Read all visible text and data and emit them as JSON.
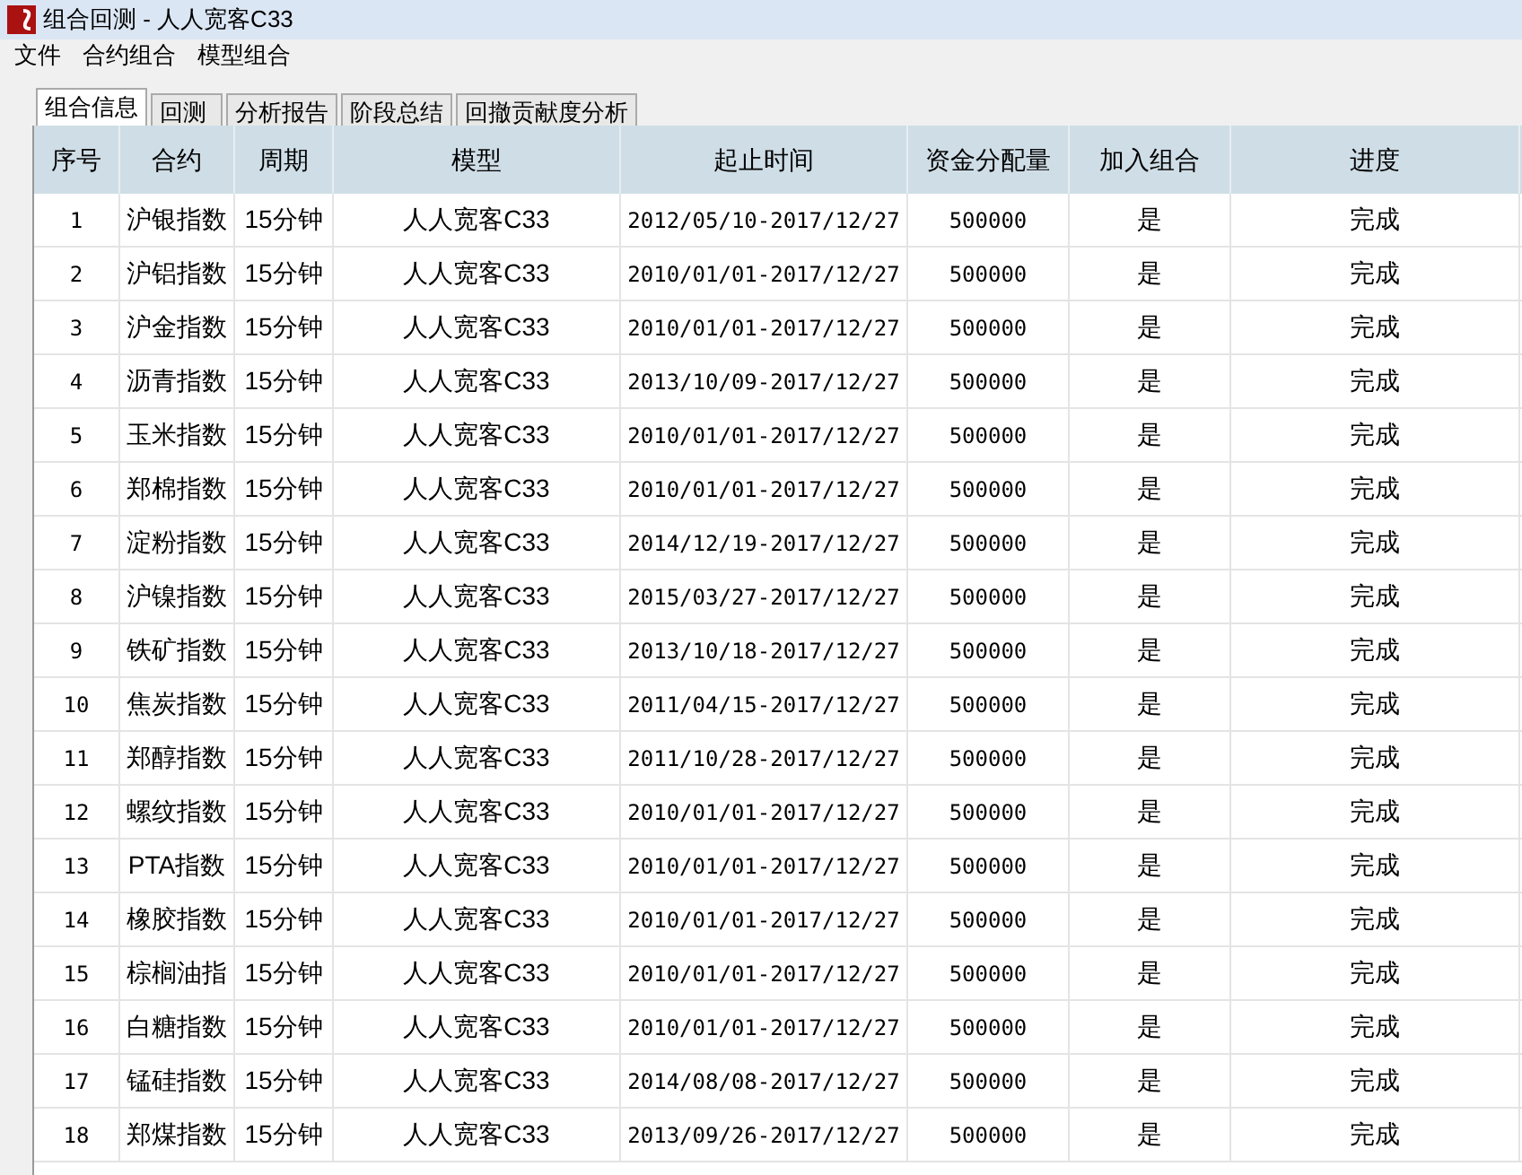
{
  "window": {
    "title": "组合回测 - 人人宽客C33"
  },
  "menu": [
    "文件",
    "合约组合",
    "模型组合"
  ],
  "tabs": [
    {
      "label": "组合信息",
      "selected": true
    },
    {
      "label": "回测",
      "selected": false
    },
    {
      "label": "分析报告",
      "selected": false
    },
    {
      "label": "阶段总结",
      "selected": false
    },
    {
      "label": "回撤贡献度分析",
      "selected": false
    }
  ],
  "table": {
    "columns": [
      "序号",
      "合约",
      "周期",
      "模型",
      "起止时间",
      "资金分配量",
      "加入组合",
      "进度"
    ],
    "rows": [
      [
        "1",
        "沪银指数",
        "15分钟",
        "人人宽客C33",
        "2012/05/10-2017/12/27",
        "500000",
        "是",
        "完成"
      ],
      [
        "2",
        "沪铝指数",
        "15分钟",
        "人人宽客C33",
        "2010/01/01-2017/12/27",
        "500000",
        "是",
        "完成"
      ],
      [
        "3",
        "沪金指数",
        "15分钟",
        "人人宽客C33",
        "2010/01/01-2017/12/27",
        "500000",
        "是",
        "完成"
      ],
      [
        "4",
        "沥青指数",
        "15分钟",
        "人人宽客C33",
        "2013/10/09-2017/12/27",
        "500000",
        "是",
        "完成"
      ],
      [
        "5",
        "玉米指数",
        "15分钟",
        "人人宽客C33",
        "2010/01/01-2017/12/27",
        "500000",
        "是",
        "完成"
      ],
      [
        "6",
        "郑棉指数",
        "15分钟",
        "人人宽客C33",
        "2010/01/01-2017/12/27",
        "500000",
        "是",
        "完成"
      ],
      [
        "7",
        "淀粉指数",
        "15分钟",
        "人人宽客C33",
        "2014/12/19-2017/12/27",
        "500000",
        "是",
        "完成"
      ],
      [
        "8",
        "沪镍指数",
        "15分钟",
        "人人宽客C33",
        "2015/03/27-2017/12/27",
        "500000",
        "是",
        "完成"
      ],
      [
        "9",
        "铁矿指数",
        "15分钟",
        "人人宽客C33",
        "2013/10/18-2017/12/27",
        "500000",
        "是",
        "完成"
      ],
      [
        "10",
        "焦炭指数",
        "15分钟",
        "人人宽客C33",
        "2011/04/15-2017/12/27",
        "500000",
        "是",
        "完成"
      ],
      [
        "11",
        "郑醇指数",
        "15分钟",
        "人人宽客C33",
        "2011/10/28-2017/12/27",
        "500000",
        "是",
        "完成"
      ],
      [
        "12",
        "螺纹指数",
        "15分钟",
        "人人宽客C33",
        "2010/01/01-2017/12/27",
        "500000",
        "是",
        "完成"
      ],
      [
        "13",
        "PTA指数",
        "15分钟",
        "人人宽客C33",
        "2010/01/01-2017/12/27",
        "500000",
        "是",
        "完成"
      ],
      [
        "14",
        "橡胶指数",
        "15分钟",
        "人人宽客C33",
        "2010/01/01-2017/12/27",
        "500000",
        "是",
        "完成"
      ],
      [
        "15",
        "棕榈油指",
        "15分钟",
        "人人宽客C33",
        "2010/01/01-2017/12/27",
        "500000",
        "是",
        "完成"
      ],
      [
        "16",
        "白糖指数",
        "15分钟",
        "人人宽客C33",
        "2010/01/01-2017/12/27",
        "500000",
        "是",
        "完成"
      ],
      [
        "17",
        "锰硅指数",
        "15分钟",
        "人人宽客C33",
        "2014/08/08-2017/12/27",
        "500000",
        "是",
        "完成"
      ],
      [
        "18",
        "郑煤指数",
        "15分钟",
        "人人宽客C33",
        "2013/09/26-2017/12/27",
        "500000",
        "是",
        "完成"
      ]
    ]
  }
}
